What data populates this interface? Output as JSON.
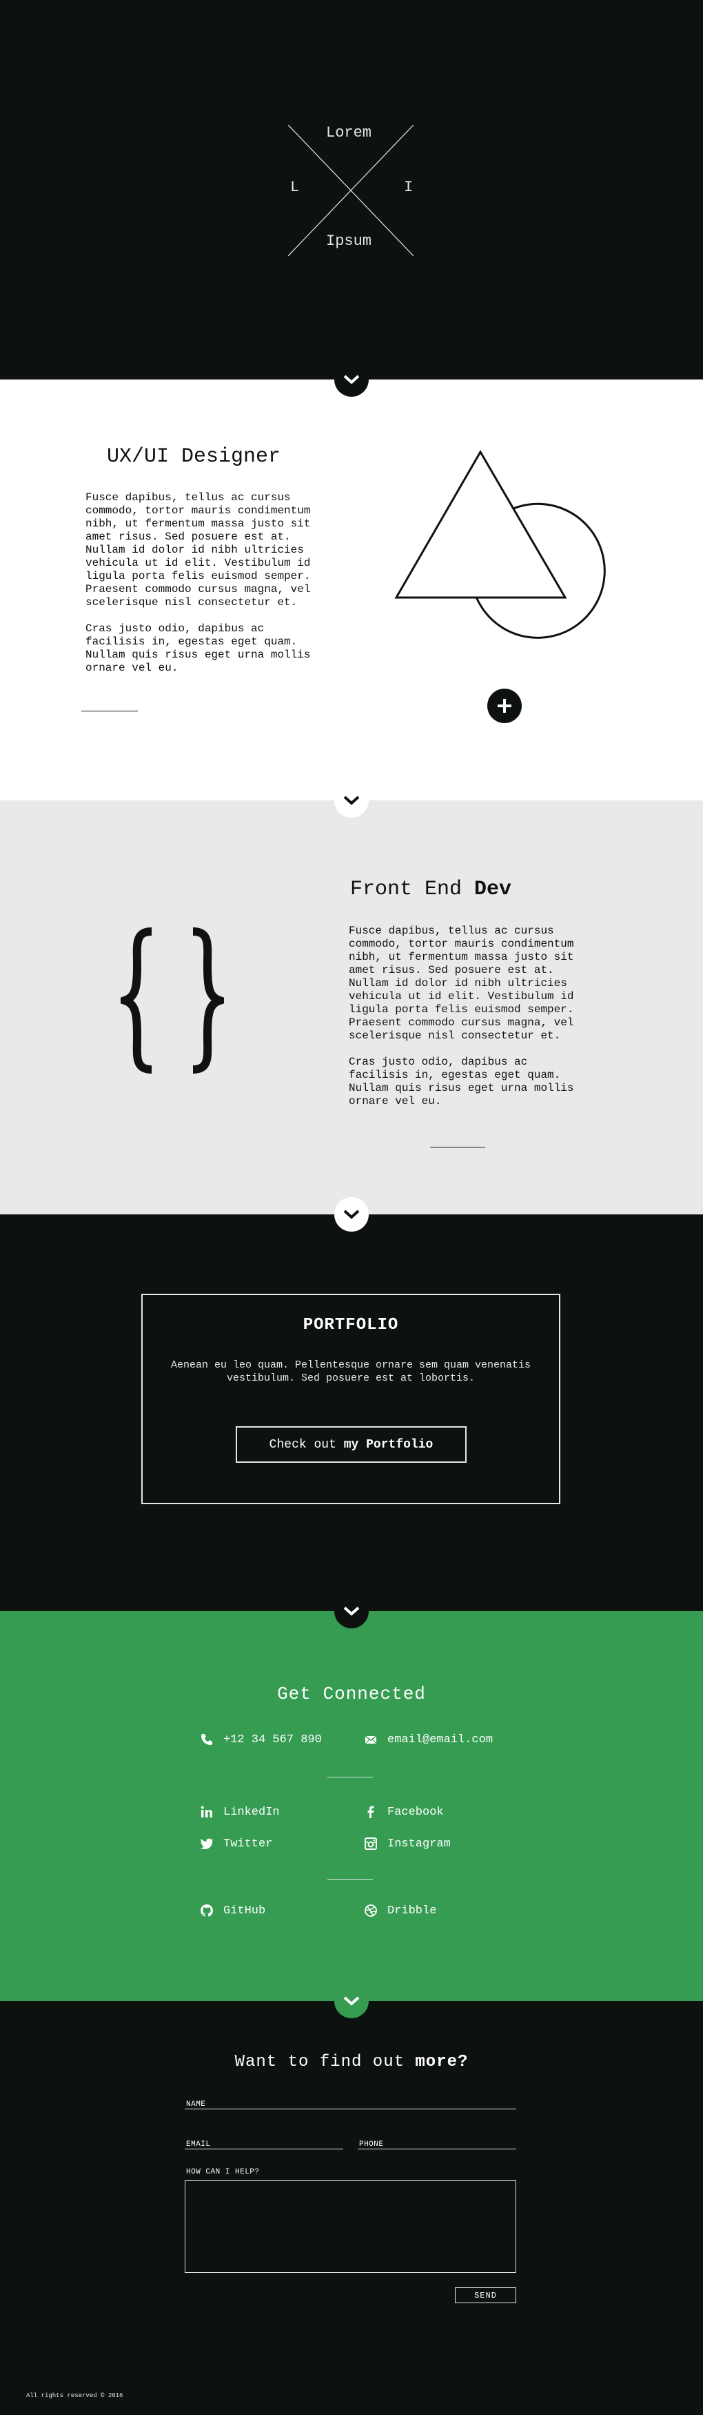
{
  "hero": {
    "logo": {
      "top": "Lorem",
      "bottom": "Ipsum",
      "left": "L",
      "right": "I"
    }
  },
  "ux": {
    "title": "UX/UI Designer",
    "paragraphs": [
      "Fusce dapibus, tellus ac cursus commodo, tortor mauris condimentum nibh, ut fermentum massa justo sit amet risus. Sed posuere est at. Nullam id dolor id nibh ultricies vehicula ut id elit. Vestibulum id ligula porta felis euismod semper. Praesent commodo cursus magna, vel scelerisque nisl consectetur et.",
      "Cras justo odio, dapibus ac facilisis in, egestas eget quam. Nullam quis risus eget urna mollis ornare vel eu."
    ],
    "add_icon": "plus-icon"
  },
  "fe": {
    "title_part1": "Front End ",
    "title_part2": "Dev",
    "icon": "curly-braces-icon",
    "paragraphs": [
      "Fusce dapibus, tellus ac cursus commodo, tortor mauris condimentum nibh, ut fermentum massa justo sit amet risus. Sed posuere est at. Nullam id dolor id nibh ultricies vehicula ut id elit. Vestibulum id ligula porta felis euismod semper. Praesent commodo cursus magna, vel scelerisque nisl consectetur et.",
      "Cras justo odio, dapibus ac facilisis in, egestas eget quam. Nullam quis risus eget urna mollis ornare vel eu."
    ]
  },
  "portfolio": {
    "title": "PORTFOLIO",
    "text": "Aenean eu leo quam. Pellentesque ornare sem quam venenatis vestibulum. Sed posuere est at lobortis.",
    "button_part1": "Check out ",
    "button_part2": "my Portfolio"
  },
  "connect": {
    "title": "Get Connected",
    "phone": "+12 34 567 890",
    "email": "email@email.com",
    "socials": [
      "LinkedIn",
      "Facebook",
      "Twitter",
      "Instagram"
    ],
    "dev": [
      "GitHub",
      "Dribble"
    ]
  },
  "contact": {
    "title_part1": "Want to find out ",
    "title_part2": "more?",
    "name_label": "NAME",
    "email_label": "EMAIL",
    "phone_label": "PHONE",
    "message_label": "HOW CAN I HELP?",
    "send_label": "SEND",
    "footer": "All rights reserved © 2016"
  },
  "colors": {
    "dark": "#0d120f",
    "green": "#359c52",
    "light_gray": "#e9e9e9"
  }
}
